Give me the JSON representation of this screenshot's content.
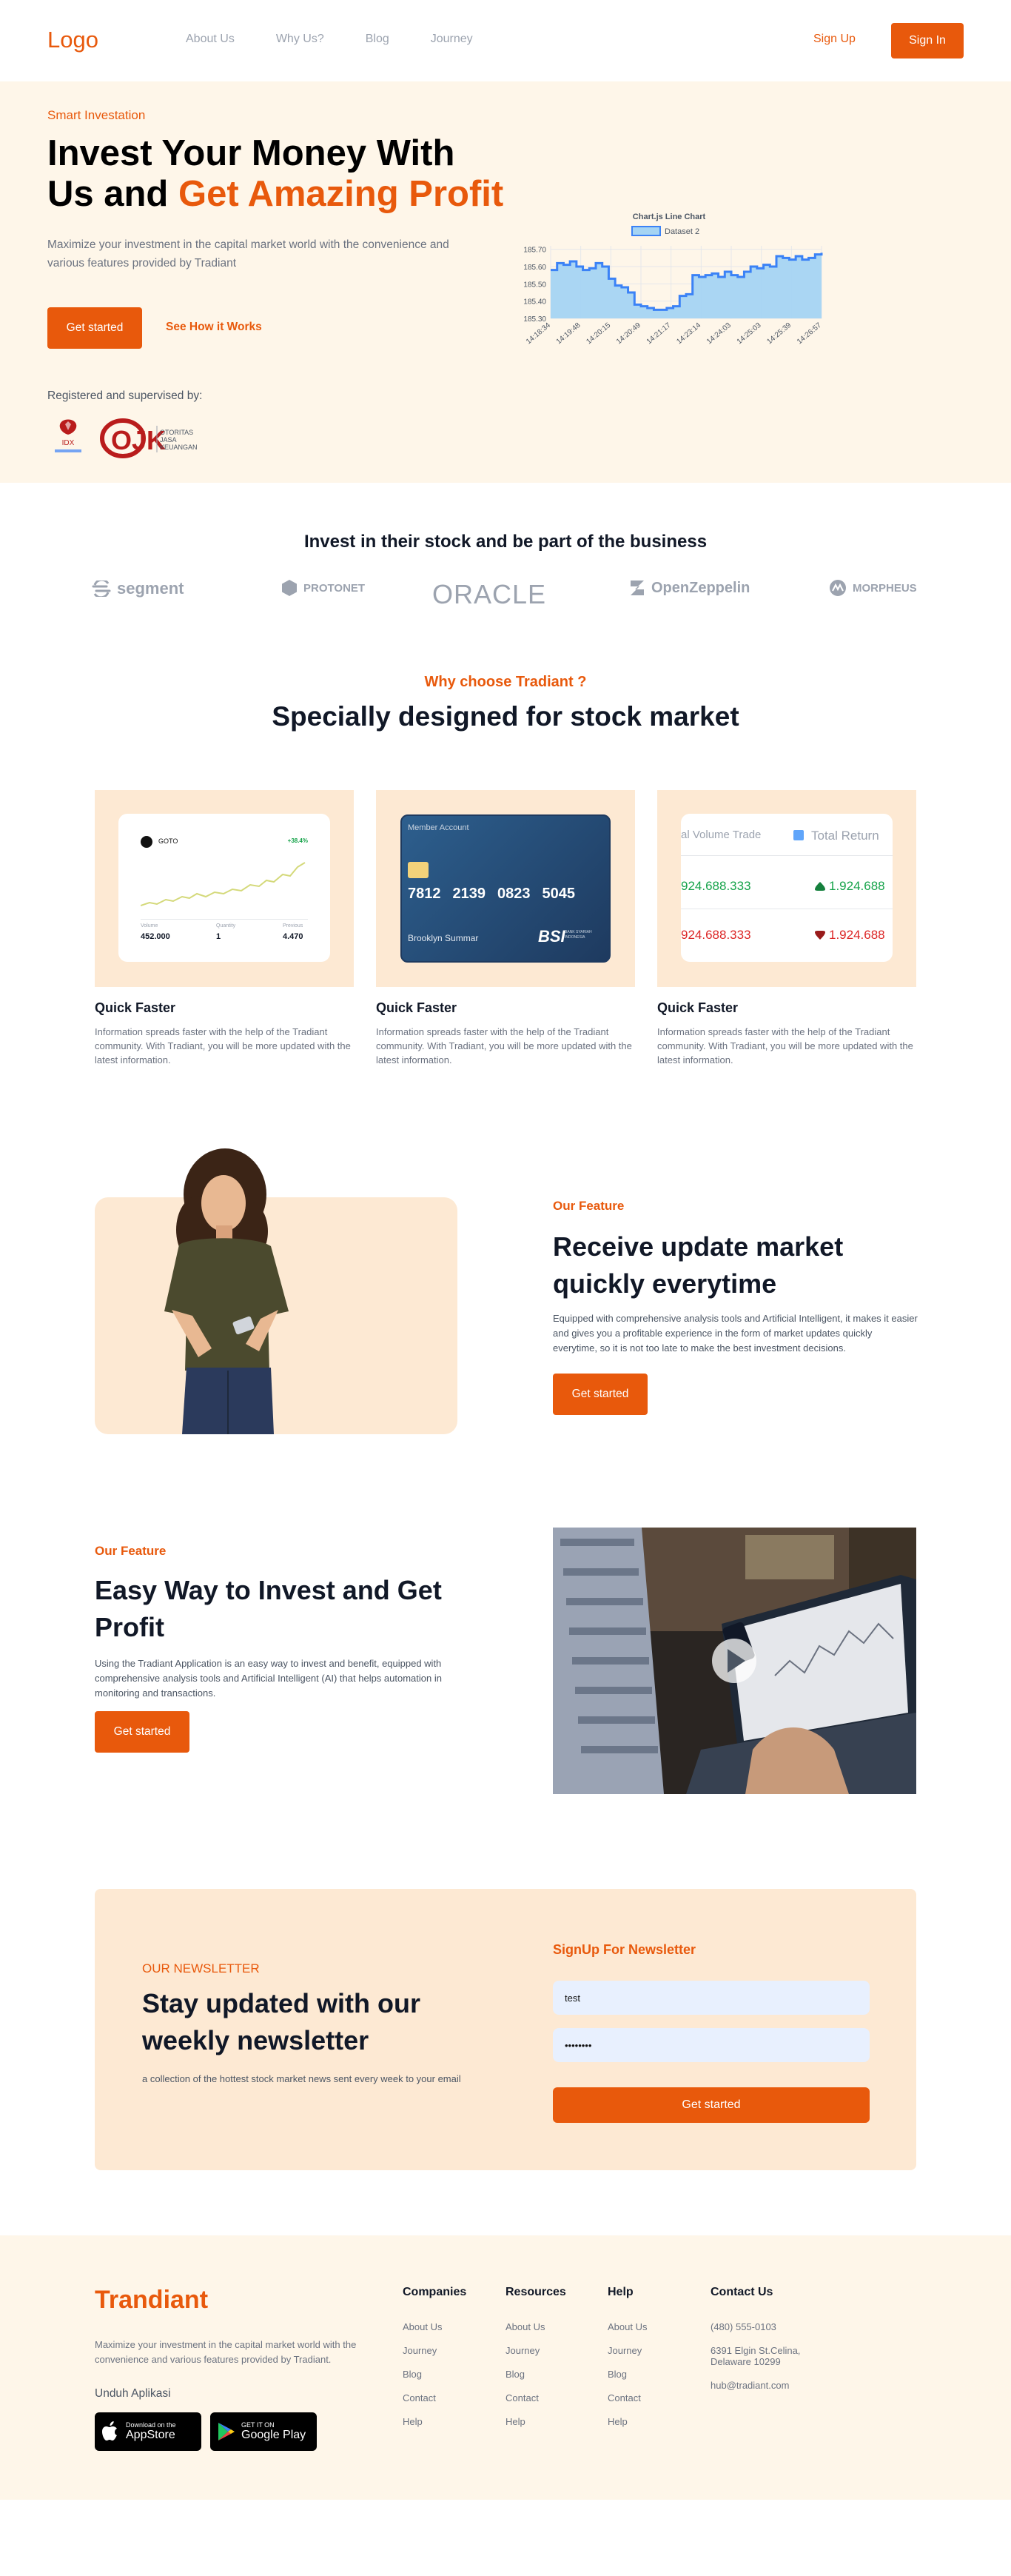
{
  "nav": {
    "logo": "Logo",
    "links": [
      "About Us",
      "Why Us?",
      "Blog",
      "Journey"
    ],
    "sign_up": "Sign Up",
    "sign_in": "Sign In"
  },
  "hero": {
    "kicker": "Smart Investation",
    "title_line1": "Invest Your Money With",
    "title_line2_prefix": "Us and",
    "title_highlight": "Get Amazing Profit",
    "description": "Maximize your investment in the capital market world with the convenience and various features provided by Tradiant",
    "cta_primary": "Get started",
    "cta_secondary": "See How it Works",
    "registered_label": "Registered and supervised by:",
    "idx_text": "IDX",
    "ojk_text": "OJK",
    "ojk_subtext": [
      "OTORITAS",
      "JASA",
      "KEUANGAN"
    ]
  },
  "chart_data": {
    "type": "line",
    "title": "Chart.js Line Chart",
    "legend": "top",
    "series": [
      {
        "name": "Dataset 2",
        "color": "#3b82f6",
        "fill": "#a5d4f3",
        "values": [
          185.58,
          185.62,
          185.61,
          185.63,
          185.6,
          185.58,
          185.59,
          185.62,
          185.6,
          185.53,
          185.49,
          185.48,
          185.45,
          185.38,
          185.37,
          185.36,
          185.35,
          185.35,
          185.36,
          185.37,
          185.43,
          185.44,
          185.55,
          185.54,
          185.55,
          185.56,
          185.54,
          185.57,
          185.55,
          185.54,
          185.57,
          185.6,
          185.59,
          185.61,
          185.6,
          185.66,
          185.65,
          185.64,
          185.66,
          185.64,
          185.65,
          185.67,
          185.68
        ]
      }
    ],
    "x_ticks": [
      "14:18:34",
      "14:19:48",
      "14:20:15",
      "14:20:49",
      "14:21:17",
      "14:23:14",
      "14:24:03",
      "14:25:03",
      "14:25:39",
      "14:26:57"
    ],
    "y_ticks": [
      185.3,
      185.4,
      185.5,
      185.6,
      185.7
    ],
    "ylim": [
      185.3,
      185.72
    ],
    "grid": true
  },
  "partners": {
    "title": "Invest in their stock and be part of the business",
    "brands": [
      "segment",
      "PROTONET",
      "ORACLE",
      "OpenZeppelin",
      "MORPHEUS"
    ]
  },
  "why": {
    "kicker": "Why choose Tradiant ?",
    "title": "Specially designed for stock market",
    "cards": [
      {
        "title": "Quick Faster",
        "desc": "Information spreads faster with the help of the Tradiant community. With Tradiant, you will be more updated with the latest information."
      },
      {
        "title": "Quick Faster",
        "desc": "Information spreads faster with the help of the Tradiant community. With Tradiant, you will be more updated with the latest information."
      },
      {
        "title": "Quick Faster",
        "desc": "Information spreads faster with the help of the Tradiant community. With Tradiant, you will be more updated with the latest information."
      }
    ],
    "stock_card": {
      "ticker": "GOTO",
      "change": "+38.4%",
      "labels": [
        "Volume",
        "Quantity",
        "Previous"
      ],
      "values": [
        "452.000",
        "1",
        "4.470"
      ]
    },
    "bank_card": {
      "label": "Member Account",
      "number": [
        "7812",
        "2139",
        "0823",
        "5045"
      ],
      "holder": "Brooklyn Summar",
      "bank": "BSI",
      "bank_sub": "BANK SYARIAH INDONESIA"
    },
    "trade_card": {
      "col1": "al Volume Trade",
      "col2": "Total Return",
      "row1": [
        "924.688.333",
        "1.924.688"
      ],
      "row2": [
        "924.688.333",
        "1.924.688"
      ]
    }
  },
  "feature1": {
    "kicker": "Our Feature",
    "title": "Receive update market quickly everytime",
    "desc": "Equipped with comprehensive analysis tools and Artificial Intelligent, it makes it easier and gives you a profitable experience in the form of market updates quickly everytime, so it is not too late to make the best investment decisions.",
    "cta": "Get started"
  },
  "feature2": {
    "kicker": "Our Feature",
    "title": "Easy Way to Invest and Get Profit",
    "desc": "Using the Tradiant Application is an easy way to invest and benefit, equipped with comprehensive analysis tools and Artificial Intelligent (AI) that helps automation in monitoring and transactions.",
    "cta": "Get started"
  },
  "newsletter": {
    "kicker": "OUR NEWSLETTER",
    "title": "Stay updated with our weekly newsletter",
    "desc": "a collection of the hottest stock market news sent every week to your email",
    "form_title": "SignUp For Newsletter",
    "name_value": "test",
    "password_value": "••••••••",
    "cta": "Get started"
  },
  "footer": {
    "logo": "Trandiant",
    "desc": "Maximize your investment in the capital market world with the convenience and various features provided by Tradiant.",
    "app_label": "Unduh Aplikasi",
    "appstore_small": "Download on the",
    "appstore_big": "AppStore",
    "play_small": "GET IT ON",
    "play_big": "Google Play",
    "columns": [
      {
        "title": "Companies",
        "links": [
          "About Us",
          "Journey",
          "Blog",
          "Contact",
          "Help"
        ]
      },
      {
        "title": "Resources",
        "links": [
          "About Us",
          "Journey",
          "Blog",
          "Contact",
          "Help"
        ]
      },
      {
        "title": "Help",
        "links": [
          "About Us",
          "Journey",
          "Blog",
          "Contact",
          "Help"
        ]
      }
    ],
    "contact": {
      "title": "Contact Us",
      "phone": "(480) 555-0103",
      "address": "6391 Elgin St.Celina, Delaware 10299",
      "email": "hub@tradiant.com"
    }
  },
  "colors": {
    "accent": "#e8590c",
    "hero_bg": "#fef6e9",
    "card_bg": "#fde9d3"
  }
}
